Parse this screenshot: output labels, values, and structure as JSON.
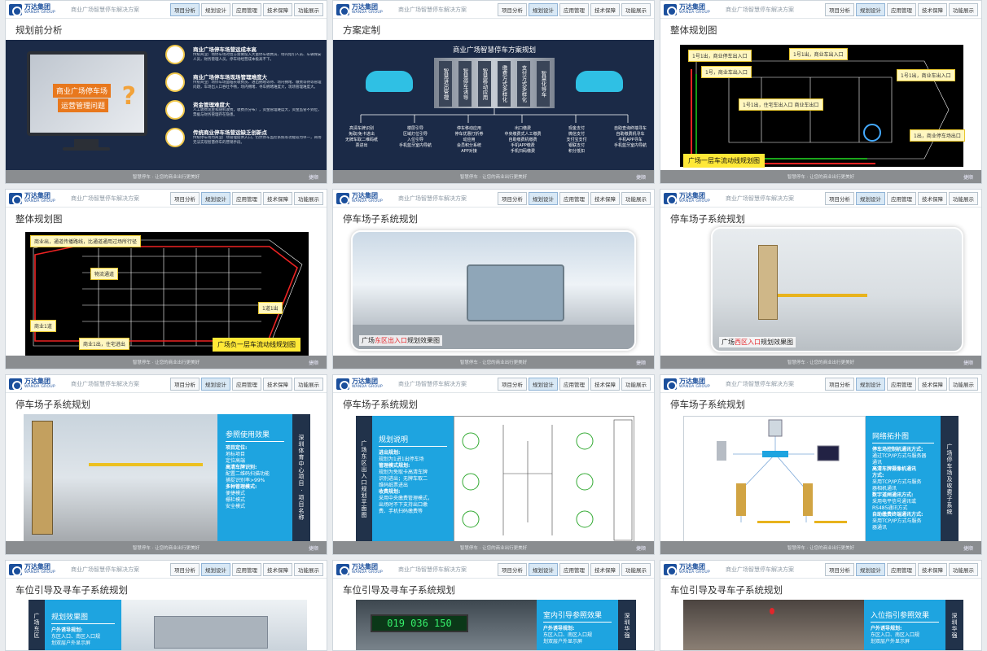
{
  "common": {
    "logo_main": "万达集团",
    "logo_sub": "WANDA GROUP",
    "deck_title": "商业广场智慧停车解决方案",
    "nav": [
      "项目分析",
      "规划设计",
      "应用管理",
      "技术保障",
      "功能展示"
    ],
    "footer_text": "智慧停车 · 让您的商业出行更美好",
    "footer_logo": "捷顺"
  },
  "slides": [
    {
      "heading": "规划前分析",
      "active_nav": 0,
      "monitor_text": [
        "商业广场停车场",
        "运营管理问题"
      ],
      "items": [
        {
          "title": "商业广场停车场营运成本高",
          "body": "传统商业广场停车场对营方需要投入大量停车收费员、场内指引人员、车辆保安人员，财务管理人员，停车场经营成本极高不下。"
        },
        {
          "title": "商业广场停车场现场管理难度大",
          "body": "传统商业广场停车场面临长收费员、进出拥堵等待、场内拥堵、缴费等待等管理问题，车场出入口吞吐不畅，场内拥堵、寻车拥堵难度大，现场管理难度大。"
        },
        {
          "title": "资金管理难度大",
          "body": "人工收费现金和随机收费，收费点分布广，资金管理难度大，资金监管不到位，票据与财务管理存在隐患。"
        },
        {
          "title": "传统商业停车场营运缺乏创新点",
          "body": "传统停车场为商业广场管理提供入口，仍然停车监控系统等功能较为单一，商场无法实现智慧停车的营销手段。"
        }
      ]
    },
    {
      "heading": "方案定制",
      "active_nav": 1,
      "banner": "商业广场智慧停车方案规划",
      "columns": [
        "智慧进出管理",
        "智慧停车诱导",
        "智慧移动应用",
        "缴费方式多样化",
        "支付方式多样化",
        "智慧化导车"
      ],
      "bottom": [
        [
          "高清车牌识别",
          "免取/免卡进出",
          "无牌车取二维码纸",
          "票进出"
        ],
        [
          "楼层引导",
          "区域灯位引导",
          "入位引导",
          "手机蓝牙室内导航"
        ],
        [
          "停车移动应用",
          "停车优惠打折券",
          "动应用",
          "会员积分系统",
          "APP对接"
        ],
        [
          "出口缴费",
          "中央缴费式人工缴费",
          "自助缴费机缴费",
          "手机APP缴费",
          "手机扫码缴费"
        ],
        [
          "现金支付",
          "微信支付",
          "支付宝支付",
          "银联支付",
          "积分抵扣"
        ],
        [
          "自助查询终端寻车",
          "自助缴费机寻车",
          "手机APP寻车",
          "手机蓝牙室内导航"
        ]
      ]
    },
    {
      "heading": "整体规划图",
      "active_nav": 1,
      "callouts": [
        "1号1出，商业停车出入口",
        "1号1出，商业车出入口",
        "1号，商业车出入口",
        "1号1出，商业车出入口",
        "1号1出，住宅车出入口 商业车出口",
        "1出，商业停车场出口"
      ],
      "caption": "广场一层车流动线规划图"
    },
    {
      "heading": "整体规划图",
      "active_nav": 1,
      "callouts": [
        "商业出，通道传播路线，比通道通用过场所行径",
        "物流通道",
        "商业1道",
        "1道1出",
        "商业1出，住宅进出"
      ],
      "caption": "广场负一层车流动线规划图"
    },
    {
      "heading": "停车场子系统规划",
      "active_nav": 1,
      "caption_pre": "广场",
      "caption_red": "东区出入口",
      "caption_post": "规划效果图"
    },
    {
      "heading": "停车场子系统规划",
      "active_nav": 1,
      "caption_pre": "广场",
      "caption_red": "西区入口",
      "caption_post": "规划效果图"
    },
    {
      "heading": "停车场子系统规划",
      "active_nav": 1,
      "panel_title": "参照使用效果",
      "lines": [
        {
          "t": "项目定位:",
          "b": true
        },
        {
          "t": "地标项目"
        },
        {
          "t": "定位高端"
        },
        {
          "t": "高清车牌识别:",
          "b": true
        },
        {
          "t": "配置二维码扫描功能"
        },
        {
          "t": "捕捉识别率>99%"
        },
        {
          "t": "多种管理模式:",
          "b": true
        },
        {
          "t": "便捷模式"
        },
        {
          "t": "栅栏模式"
        },
        {
          "t": "安全模式"
        }
      ],
      "strip": "深圳体育中心项目 · 项目名称"
    },
    {
      "heading": "停车场子系统规划",
      "active_nav": 1,
      "strip": "广场东区出入口规划平面图",
      "panel_title": "规划说明",
      "lines": [
        {
          "t": "进出规划:",
          "b": true
        },
        {
          "t": "规划为1进1出停车场"
        },
        {
          "t": "管理模式规划:",
          "b": true
        },
        {
          "t": "规划为免取卡高清车牌",
          "b": false
        },
        {
          "t": "识别进出；无牌车取二"
        },
        {
          "t": "维码纸票进出"
        },
        {
          "t": "收费规划:",
          "b": true
        },
        {
          "t": "采用中央缴费管理模式，"
        },
        {
          "t": "出场时不下支持出口缴"
        },
        {
          "t": "费、手机扫码缴费等"
        }
      ]
    },
    {
      "heading": "停车场子系统规划",
      "active_nav": 1,
      "panel_title": "网络拓扑图",
      "lines": [
        {
          "t": "停车场控制机通讯方式:",
          "b": true
        },
        {
          "t": "通过TCP/IP方式与服务器"
        },
        {
          "t": "通讯"
        },
        {
          "t": "高清车牌摄像机通讯",
          "b": true
        },
        {
          "t": "方式:",
          "b": true
        },
        {
          "t": "采用TCP/IP方式与服务"
        },
        {
          "t": "器相机通讯"
        },
        {
          "t": "数字道闸通讯方式:",
          "b": true
        },
        {
          "t": "采用电平信号通讯或"
        },
        {
          "t": "RS485通讯方式"
        },
        {
          "t": "自助缴费终端通讯方式:",
          "b": true
        },
        {
          "t": "采用TCP/IP方式与服务"
        },
        {
          "t": "器通讯"
        }
      ],
      "strip": "广场停车场及收费子系统"
    },
    {
      "heading": "车位引导及寻车子系统规划",
      "active_nav": 1,
      "strip": "广场东区",
      "panel_title": "规划效果图",
      "lines": [
        {
          "t": "户外诱导规划:",
          "b": true
        },
        {
          "t": "东区入口、南区入口规"
        },
        {
          "t": "划双层户外显示屏"
        }
      ]
    },
    {
      "heading": "车位引导及寻车子系统规划",
      "active_nav": 1,
      "panel_title": "室内引导参照效果",
      "lines": [
        {
          "t": "户外诱导规划:",
          "b": true
        },
        {
          "t": "东区入口、南区入口规"
        },
        {
          "t": "划双层户外显示屏"
        }
      ],
      "strip": "深圳华强",
      "sign_text": "019 036 150"
    },
    {
      "heading": "车位引导及寻车子系统规划",
      "active_nav": 1,
      "panel_title": "入位指引参照效果",
      "lines": [
        {
          "t": "户外诱导规划:",
          "b": true
        },
        {
          "t": "东区入口、南区入口规"
        },
        {
          "t": "划双层户外显示屏"
        }
      ],
      "strip": "深圳华强"
    }
  ]
}
